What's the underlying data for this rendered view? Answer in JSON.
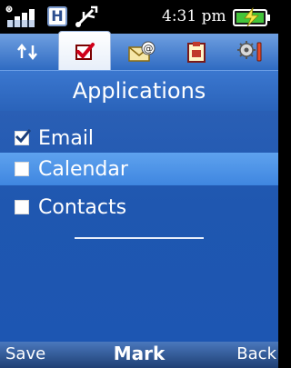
{
  "status": {
    "network_badge": "H",
    "time": "4:31 pm",
    "icons": [
      "signal-strength-icon",
      "usb-connected-icon",
      "battery-charging-icon"
    ]
  },
  "tabs": [
    {
      "icon": "sync-arrows-icon",
      "active": false
    },
    {
      "icon": "checkbox-tab-icon",
      "active": true
    },
    {
      "icon": "email-at-icon",
      "active": false
    },
    {
      "icon": "clipboard-icon",
      "active": false
    },
    {
      "icon": "gear-tools-icon",
      "active": false
    }
  ],
  "page": {
    "title": "Applications"
  },
  "list": [
    {
      "label": "Email",
      "checked": true,
      "selected": false
    },
    {
      "label": "Calendar",
      "checked": false,
      "selected": true
    },
    {
      "label": "Contacts",
      "checked": false,
      "selected": false
    }
  ],
  "softkeys": {
    "left": "Save",
    "center": "Mark",
    "right": "Back"
  },
  "colors": {
    "accent": "#2a63ba",
    "selection": "#4f93e8",
    "tab_gradient_top": "#6f9fe0"
  }
}
